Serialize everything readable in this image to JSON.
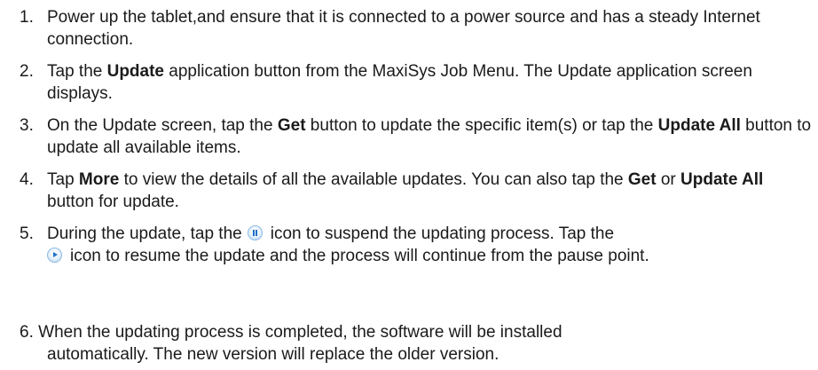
{
  "steps": [
    {
      "number": "1.",
      "text": "Power up the tablet,and ensure that it is connected to a power source and has a steady Internet connection."
    },
    {
      "number": "2.",
      "pre": "Tap the ",
      "bold": "Update",
      "post": " application button from the MaxiSys Job Menu. The Update application screen displays."
    },
    {
      "number": "3.",
      "pre": "On the Update screen, tap the ",
      "bold1": "Get",
      "mid": " button to update the specific item(s) or tap the ",
      "bold2": "Update All",
      "post": " button to update all available items."
    },
    {
      "number": "4.",
      "pre": "Tap ",
      "bold1": "More",
      "mid": " to view the details of all the available updates. You can also tap the ",
      "bold2": "Get",
      "mid2": " or ",
      "bold3": "Update All",
      "post": " button for update."
    },
    {
      "number": "5.",
      "pre": "During the update, tap the",
      "icon1": "pause-icon",
      "mid": "icon to suspend the updating process. Tap the",
      "icon2": "play-icon",
      "post": "icon to resume the update and the process will continue from the pause point."
    },
    {
      "number": "6.",
      "line1": "When the updating process is completed, the software will be installed",
      "line2": "automatically. The new version will replace the older version."
    }
  ],
  "colors": {
    "text": "#1a1a1a",
    "icon_accent": "#1f6fc8"
  }
}
